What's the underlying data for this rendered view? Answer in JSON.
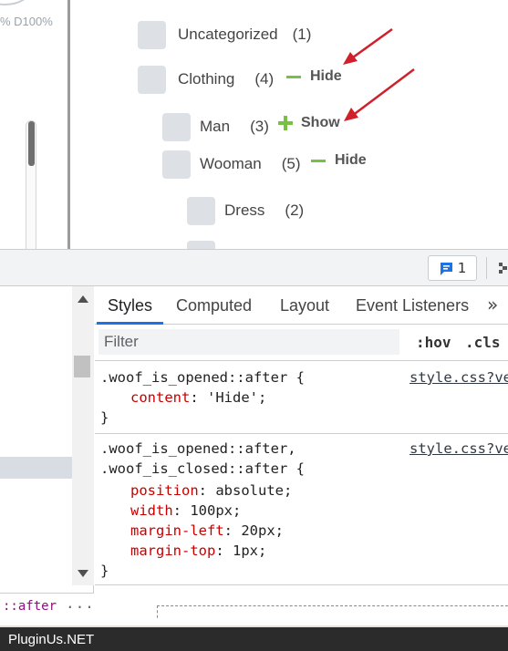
{
  "page": {
    "gauge_text": "% D100%",
    "categories": [
      {
        "label": "Uncategorized",
        "count": "(1)"
      },
      {
        "label": "Clothing",
        "count": "(4)",
        "toggle": "Hide"
      },
      {
        "label": "Man",
        "count": "(3)",
        "toggle": "Show"
      },
      {
        "label": "Wooman",
        "count": "(5)",
        "toggle": "Hide"
      },
      {
        "label": "Dress",
        "count": "(2)"
      }
    ],
    "accent_color": "#78c043",
    "arrow_color": "#d0202a"
  },
  "devtools": {
    "issues_count": "1",
    "tabs": [
      "Styles",
      "Computed",
      "Layout",
      "Event Listeners"
    ],
    "more_tabs_icon": "»",
    "filter_placeholder": "Filter",
    "hov_label": ":hov",
    "cls_label": ".cls",
    "rules": [
      {
        "selector": ".woof_is_opened::after {",
        "source": "style.css?ve",
        "declarations": [
          {
            "prop": "content",
            "value": "'Hide';"
          }
        ],
        "close": "}"
      },
      {
        "selector_line1": ".woof_is_opened::after,",
        "selector_line2": ".woof_is_closed::after {",
        "source": "style.css?ve",
        "declarations": [
          {
            "prop": "position",
            "value": "absolute;"
          },
          {
            "prop": "width",
            "value": "100px;"
          },
          {
            "prop": "margin-left",
            "value": "20px;"
          },
          {
            "prop": "margin-top",
            "value": "1px;"
          }
        ],
        "close": "}"
      }
    ],
    "breadcrumb": "::after",
    "breadcrumb_more": "..."
  },
  "footer": {
    "brand": "PluginUs.NET"
  }
}
